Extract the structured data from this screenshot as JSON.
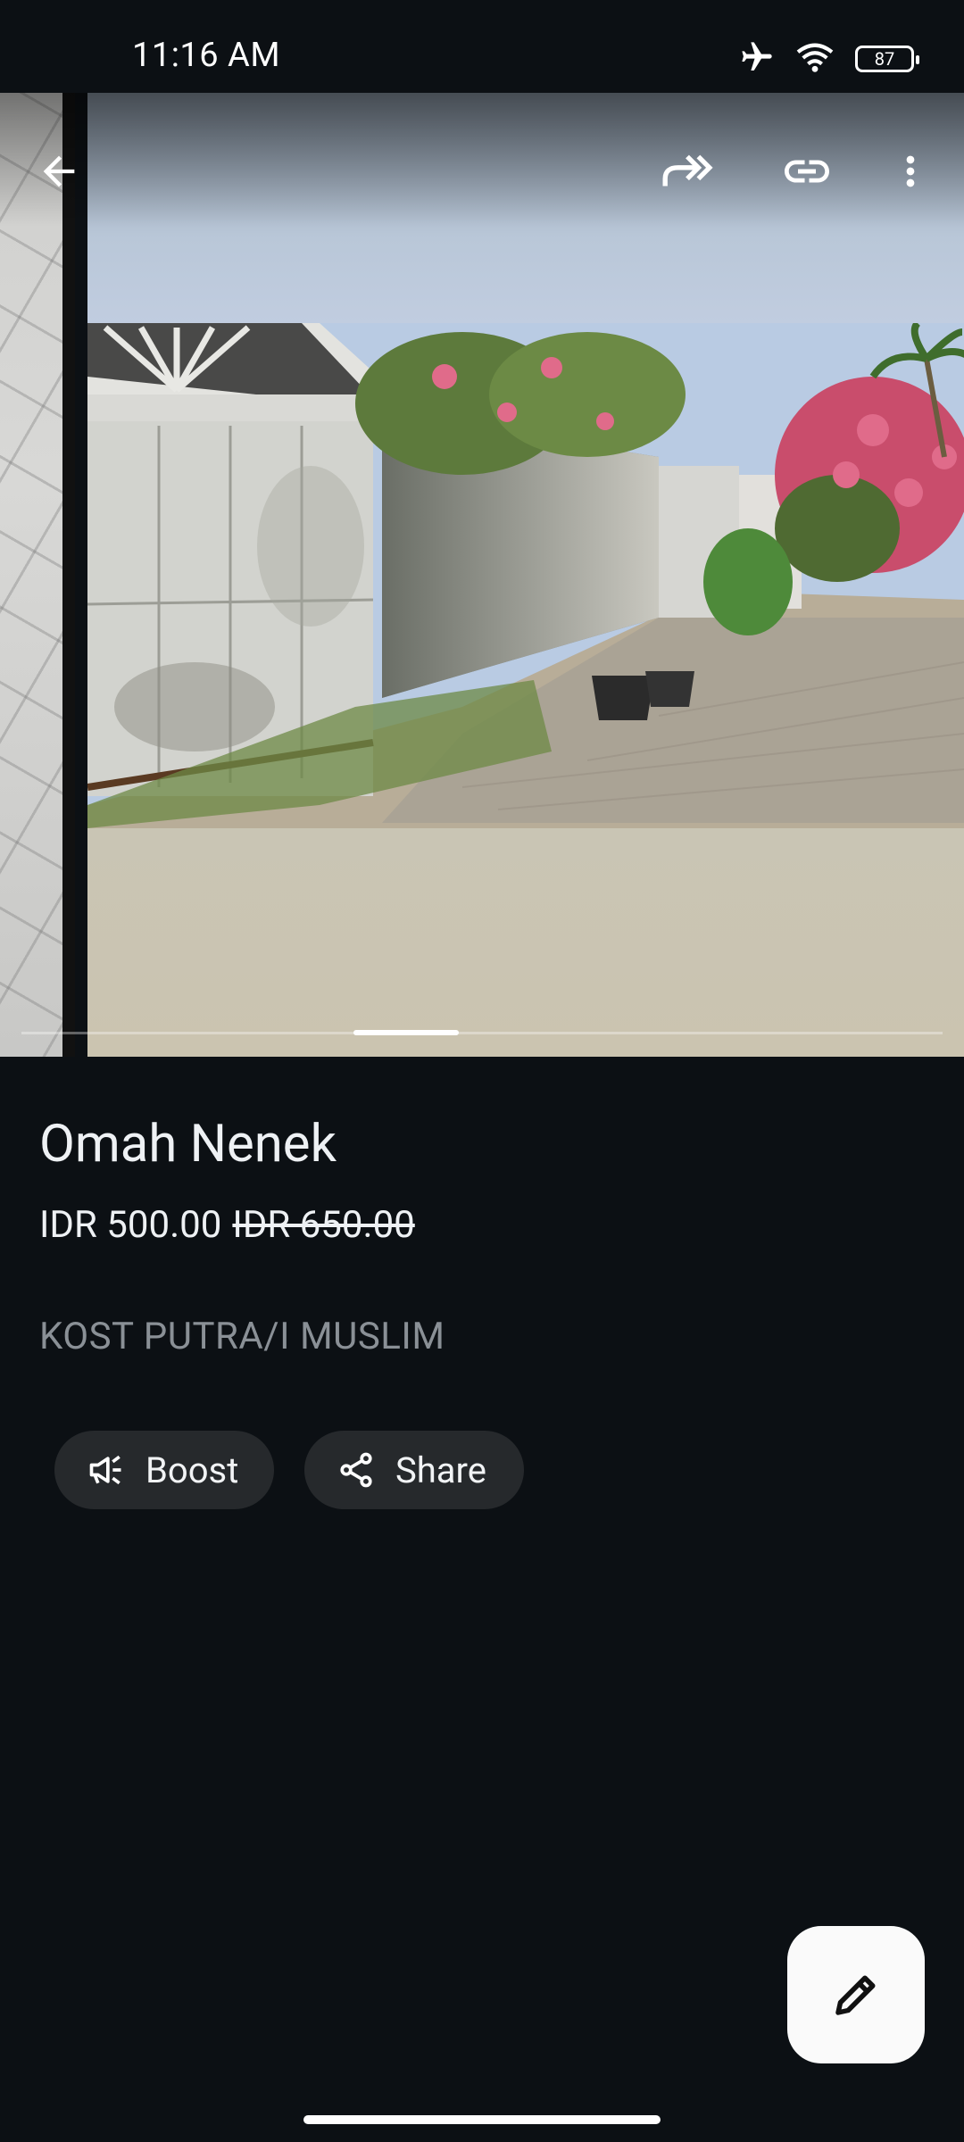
{
  "status_bar": {
    "time": "11:16 AM",
    "battery": "87",
    "icons": [
      "airplane-mode-icon",
      "wifi-icon",
      "battery-icon"
    ]
  },
  "toolbar": {
    "icons": [
      "back-arrow-icon",
      "forward-icon",
      "link-icon",
      "more-vert-icon"
    ]
  },
  "gallery": {
    "photo_count_hint": "carousel",
    "current_index": 2
  },
  "listing": {
    "title": "Omah Nenek",
    "price": "IDR 500.00",
    "original_price": "IDR 650.00",
    "category": "KOST PUTRA/I MUSLIM"
  },
  "actions": {
    "boost_label": "Boost",
    "share_label": "Share"
  },
  "colors": {
    "background": "#0c1014",
    "chip": "#26292c",
    "fab": "#fafafa",
    "secondary_text": "#8a9096"
  }
}
